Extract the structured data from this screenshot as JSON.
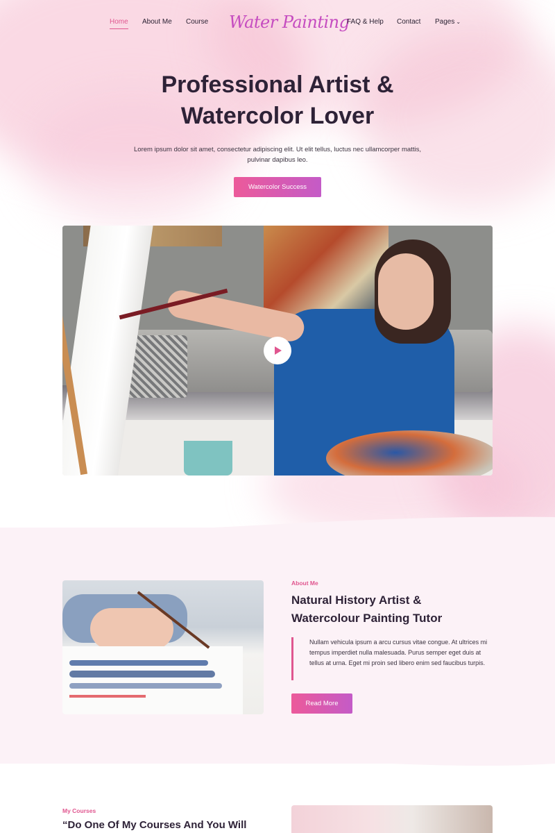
{
  "nav": {
    "items": [
      {
        "label": "Home",
        "active": true
      },
      {
        "label": "About Me"
      },
      {
        "label": "Course"
      },
      {
        "label": "FAQ & Help"
      },
      {
        "label": "Contact"
      },
      {
        "label": "Pages"
      }
    ],
    "logo": "Water Painting"
  },
  "hero": {
    "title_line1": "Professional Artist &",
    "title_line2": "Watercolor Lover",
    "text": "Lorem ipsum dolor sit amet, consectetur adipiscing elit. Ut elit tellus, luctus nec ullamcorper mattis, pulvinar dapibus leo.",
    "button": "Watercolor Success"
  },
  "about": {
    "eyebrow": "About Me",
    "title_line1": "Natural History Artist &",
    "title_line2": "Watercolour Painting Tutor",
    "text": "Nullam vehicula ipsum a arcu cursus vitae congue. At ultrices mi tempus imperdiet nulla malesuada. Purus semper eget duis at tellus at urna. Eget mi proin sed libero enim sed faucibus turpis.",
    "button": "Read More"
  },
  "courses": {
    "eyebrow": "My Courses",
    "title": "“Do One Of My Courses And You Will"
  },
  "colors": {
    "accent": "#e0568f",
    "gradient_start": "#ec5a9a",
    "gradient_end": "#c45bc7",
    "heading": "#2e2237"
  }
}
